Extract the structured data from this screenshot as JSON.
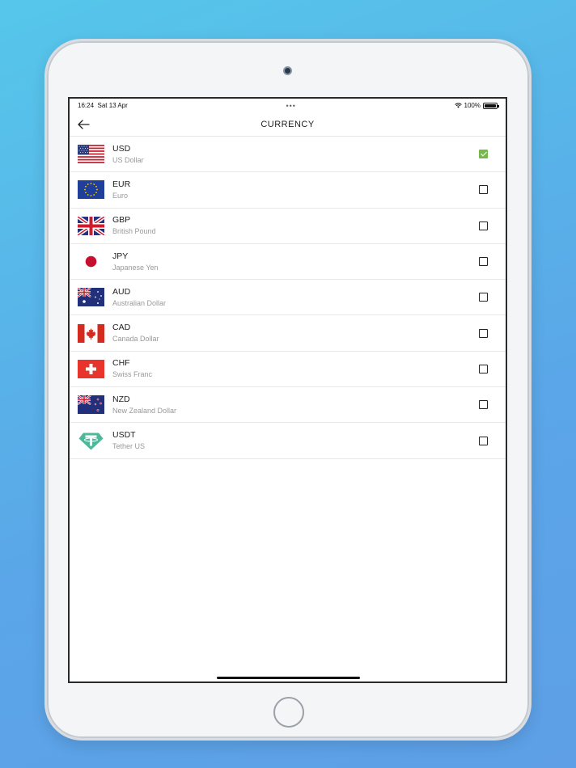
{
  "status_bar": {
    "time": "16:24",
    "date": "Sat 13 Apr",
    "dots": "•••",
    "battery": "100%"
  },
  "header": {
    "title": "CURRENCY",
    "back_icon": "arrow-left-icon"
  },
  "currencies": [
    {
      "code": "USD",
      "name": "US Dollar",
      "flag": "us-flag-icon",
      "selected": true
    },
    {
      "code": "EUR",
      "name": "Euro",
      "flag": "eu-flag-icon",
      "selected": false
    },
    {
      "code": "GBP",
      "name": "British Pound",
      "flag": "uk-flag-icon",
      "selected": false
    },
    {
      "code": "JPY",
      "name": "Japanese Yen",
      "flag": "jp-flag-icon",
      "selected": false
    },
    {
      "code": "AUD",
      "name": "Australian Dollar",
      "flag": "au-flag-icon",
      "selected": false
    },
    {
      "code": "CAD",
      "name": "Canada Dollar",
      "flag": "ca-flag-icon",
      "selected": false
    },
    {
      "code": "CHF",
      "name": "Swiss Franc",
      "flag": "ch-flag-icon",
      "selected": false
    },
    {
      "code": "NZD",
      "name": "New Zealand Dollar",
      "flag": "nz-flag-icon",
      "selected": false
    },
    {
      "code": "USDT",
      "name": "Tether US",
      "flag": "tether-icon",
      "selected": false
    }
  ],
  "colors": {
    "check_green": "#77b84a",
    "tether_teal": "#4fb89a"
  }
}
